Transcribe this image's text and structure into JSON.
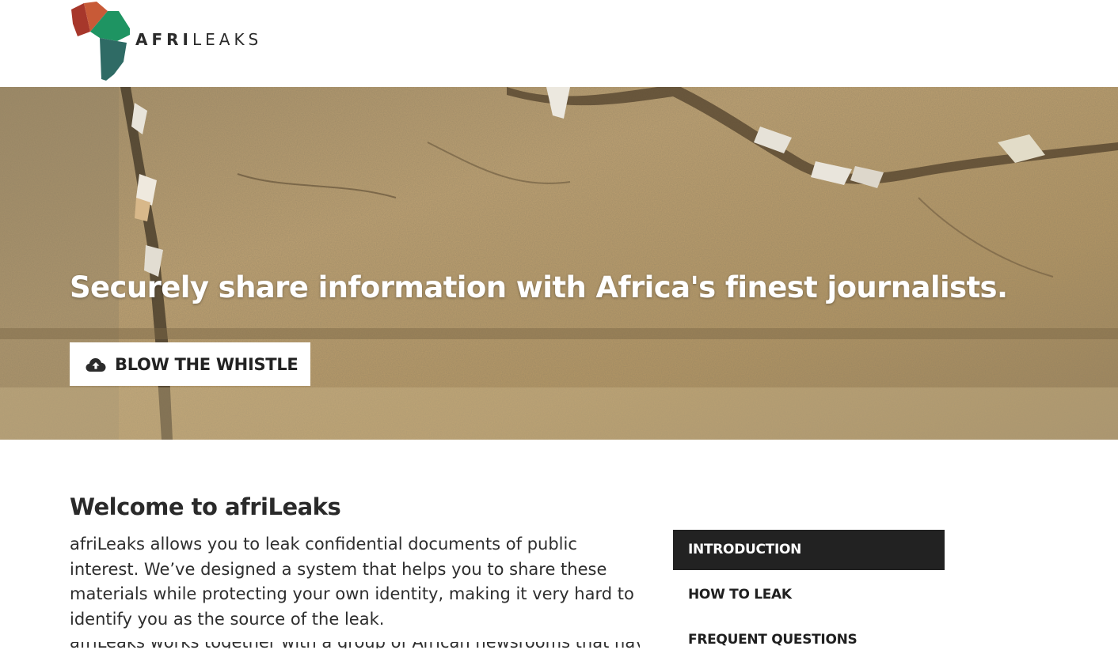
{
  "header": {
    "logo_text_bold": "AFRI",
    "logo_text_light": "LEAKS"
  },
  "hero": {
    "title": "Securely share information with Africa's finest journalists.",
    "button_label": "BLOW THE WHISTLE",
    "button_icon": "cloud-upload-icon"
  },
  "main": {
    "welcome_title": "Welcome to afriLeaks",
    "intro_paragraph": "afriLeaks allows you to leak confidential documents of public interest. We’ve designed a system that helps you to share these materials while protecting your own identity, making it very hard to identify you as the source of the leak.",
    "next_paragraph_partial": "afriLeaks works together with a group of African newsrooms that have taken"
  },
  "side_nav": {
    "items": [
      {
        "label": "INTRODUCTION",
        "active": true
      },
      {
        "label": "HOW TO LEAK",
        "active": false
      },
      {
        "label": "FREQUENT QUESTIONS",
        "active": false
      }
    ]
  },
  "colors": {
    "logo_red": "#a7372b",
    "logo_orange": "#c85a37",
    "logo_green": "#1e9462",
    "logo_teal": "#2f6b65",
    "nav_active_bg": "#222222",
    "hero_stone": "#b89c68"
  }
}
